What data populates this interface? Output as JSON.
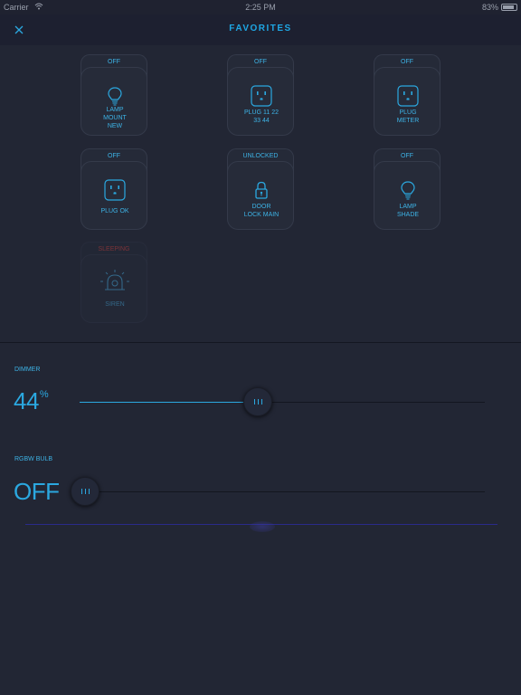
{
  "status_bar": {
    "carrier": "Carrier",
    "time": "2:25 PM",
    "battery": "83%"
  },
  "nav": {
    "title": "FAVORITES"
  },
  "tiles": [
    {
      "state": "OFF",
      "label": "LAMP\nMOUNT\nNEW",
      "icon": "lightbulb-icon"
    },
    {
      "state": "OFF",
      "label": "PLUG 11 22\n33 44",
      "icon": "outlet-icon"
    },
    {
      "state": "OFF",
      "label": "PLUG\nMETER",
      "icon": "outlet-icon"
    },
    {
      "state": "OFF",
      "label": "PLUG OK",
      "icon": "outlet-icon"
    },
    {
      "state": "UNLOCKED",
      "label": "DOOR\nLOCK MAIN",
      "icon": "lock-icon"
    },
    {
      "state": "OFF",
      "label": "LAMP\nSHADE",
      "icon": "lightbulb-icon"
    },
    {
      "state": "SLEEPING",
      "label": "SIREN",
      "icon": "siren-icon"
    }
  ],
  "dimmer": {
    "label": "DIMMER",
    "value": "44",
    "unit": "%",
    "level": 0.44
  },
  "rgbw": {
    "label": "RGBW BULB",
    "value": "OFF",
    "level": 0
  },
  "colors": {
    "accent": "#2ba8e0",
    "background": "#222634",
    "sleeping": "#b53c3c"
  }
}
